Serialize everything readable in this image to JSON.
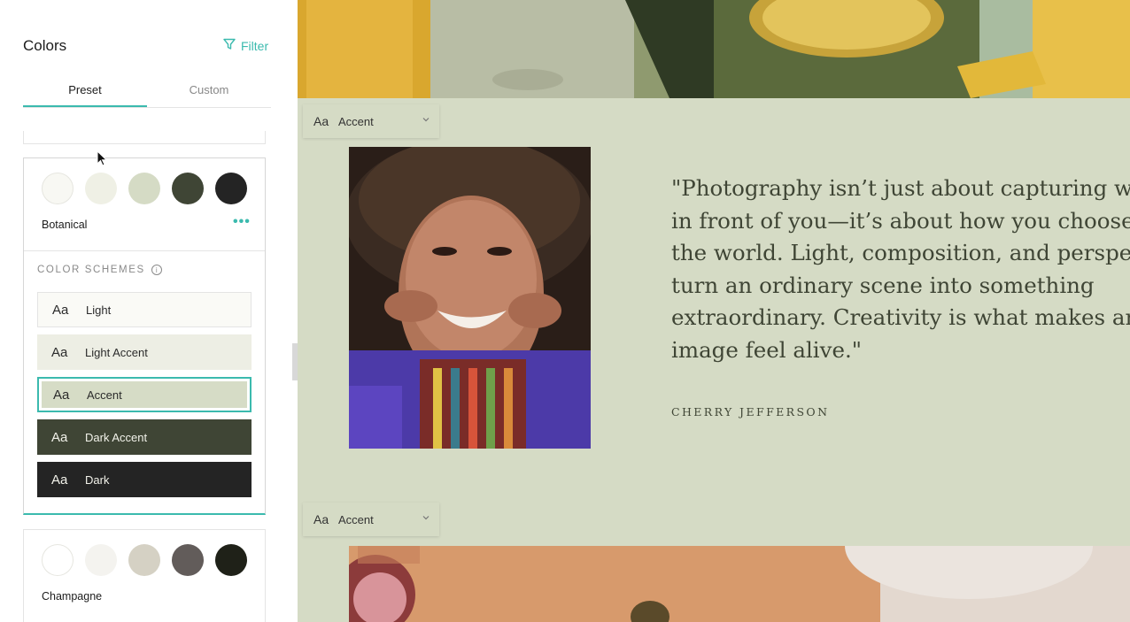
{
  "panel": {
    "title": "Colors",
    "filter_label": "Filter",
    "tabs": [
      {
        "label": "Preset",
        "active": true
      },
      {
        "label": "Custom",
        "active": false
      }
    ]
  },
  "palettes": [
    {
      "name": "Botanical",
      "selected": true,
      "swatches": [
        "#f8f8f3",
        "#eff0e5",
        "#d5dbc5",
        "#3f4535",
        "#242424"
      ],
      "more_label": "•••"
    },
    {
      "name": "Champagne",
      "selected": false,
      "swatches": [
        "#ffffff",
        "#f4f3ef",
        "#d5d1c4",
        "#625c5a",
        "#1f2118"
      ]
    }
  ],
  "color_schemes": {
    "label": "COLOR SCHEMES",
    "info_icon": "i",
    "items": [
      {
        "aa": "Aa",
        "label": "Light",
        "bg": "#fafaf6"
      },
      {
        "aa": "Aa",
        "label": "Light Accent",
        "bg": "#edeee4"
      },
      {
        "aa": "Aa",
        "label": "Accent",
        "bg": "#d6dcc6",
        "selected": true
      },
      {
        "aa": "Aa",
        "label": "Dark Accent",
        "bg": "#3f4535"
      },
      {
        "aa": "Aa",
        "label": "Dark",
        "bg": "#242424"
      }
    ]
  },
  "canvas": {
    "section_tags": [
      {
        "aa": "Aa",
        "label": "Accent"
      },
      {
        "aa": "Aa",
        "label": "Accent"
      }
    ],
    "quote": "\"Photography isn’t just about capturing wh\nin front of you—it’s about how you choose \nthe world. Light, composition, and perspec\nturn an ordinary scene into something\nextraordinary. Creativity is what makes an\nimage feel alive.\"",
    "author": "CHERRY JEFFERSON"
  },
  "colors": {
    "accent_teal": "#3bbaae",
    "section_bg": "#d5dbc5",
    "text_dark": "#3f4535"
  }
}
